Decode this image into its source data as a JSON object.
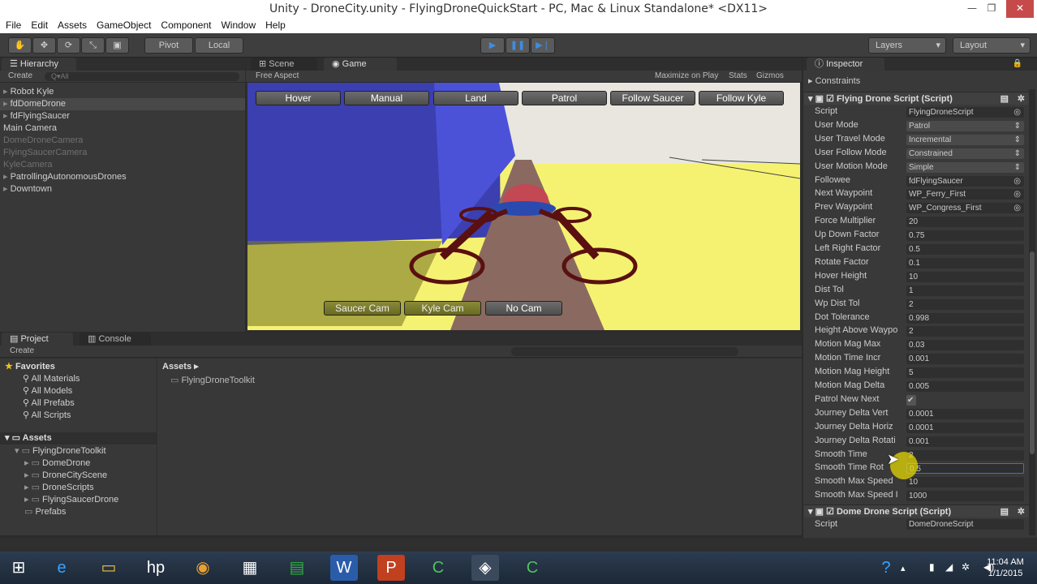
{
  "window": {
    "title": "Unity - DroneCity.unity - FlyingDroneQuickStart - PC, Mac & Linux Standalone* <DX11>"
  },
  "menu": [
    "File",
    "Edit",
    "Assets",
    "GameObject",
    "Component",
    "Window",
    "Help"
  ],
  "toolbar": {
    "pivot": "Pivot",
    "local": "Local",
    "layers": "Layers",
    "layout": "Layout"
  },
  "hierarchy": {
    "tab": "Hierarchy",
    "create": "Create",
    "search_placeholder": "Q▾All",
    "items": [
      {
        "label": "Robot Kyle",
        "dim": false,
        "arrow": true
      },
      {
        "label": "fdDomeDrone",
        "dim": false,
        "arrow": true,
        "selected": true
      },
      {
        "label": "fdFlyingSaucer",
        "dim": false,
        "arrow": true
      },
      {
        "label": "Main Camera",
        "dim": false,
        "arrow": false
      },
      {
        "label": "DomeDroneCamera",
        "dim": true,
        "arrow": false
      },
      {
        "label": "FlyingSaucerCamera",
        "dim": true,
        "arrow": false
      },
      {
        "label": "KyleCamera",
        "dim": true,
        "arrow": false
      },
      {
        "label": "PatrollingAutonomousDrones",
        "dim": false,
        "arrow": true
      },
      {
        "label": "Downtown",
        "dim": false,
        "arrow": true
      }
    ]
  },
  "scene_tab": "Scene",
  "game_tab": "Game",
  "game": {
    "aspect": "Free Aspect",
    "maximize": "Maximize on Play",
    "stats": "Stats",
    "gizmos": "Gizmos",
    "top_buttons": [
      "Hover",
      "Manual",
      "Land",
      "Patrol",
      "Follow Saucer",
      "Follow Kyle"
    ],
    "bottom_buttons": [
      "Saucer Cam",
      "Kyle Cam",
      "No Cam"
    ]
  },
  "project": {
    "tab": "Project",
    "console_tab": "Console",
    "create": "Create",
    "favorites_label": "Favorites",
    "favorites": [
      "All Materials",
      "All Models",
      "All Prefabs",
      "All Scripts"
    ],
    "assets_label": "Assets",
    "tree": [
      "FlyingDroneToolkit",
      "DomeDrone",
      "DroneCityScene",
      "DroneScripts",
      "FlyingSaucerDrone",
      "Prefabs"
    ],
    "breadcrumb": "Assets ▸",
    "content_folder": "FlyingDroneToolkit"
  },
  "inspector": {
    "tab": "Inspector",
    "constraints": "Constraints",
    "component_title": "Flying Drone Script (Script)",
    "fields": [
      {
        "label": "Script",
        "value": "FlyingDroneScript",
        "kind": "obj"
      },
      {
        "label": "User Mode",
        "value": "Patrol",
        "kind": "drop"
      },
      {
        "label": "User Travel Mode",
        "value": "Incremental",
        "kind": "drop"
      },
      {
        "label": "User Follow Mode",
        "value": "Constrained",
        "kind": "drop"
      },
      {
        "label": "User Motion Mode",
        "value": "Simple",
        "kind": "drop"
      },
      {
        "label": "Followee",
        "value": "fdFlyingSaucer",
        "kind": "obj"
      },
      {
        "label": "Next Waypoint",
        "value": "WP_Ferry_First",
        "kind": "obj"
      },
      {
        "label": "Prev Waypoint",
        "value": "WP_Congress_First",
        "kind": "obj"
      },
      {
        "label": "Force Multiplier",
        "value": "20",
        "kind": "field"
      },
      {
        "label": "Up Down Factor",
        "value": "0.75",
        "kind": "field"
      },
      {
        "label": "Left Right Factor",
        "value": "0.5",
        "kind": "field"
      },
      {
        "label": "Rotate Factor",
        "value": "0.1",
        "kind": "field"
      },
      {
        "label": "Hover Height",
        "value": "10",
        "kind": "field"
      },
      {
        "label": "Dist Tol",
        "value": "1",
        "kind": "field"
      },
      {
        "label": "Wp Dist Tol",
        "value": "2",
        "kind": "field"
      },
      {
        "label": "Dot Tolerance",
        "value": "0.998",
        "kind": "field"
      },
      {
        "label": "Height Above Waypo",
        "value": "2",
        "kind": "field"
      },
      {
        "label": "Motion Mag Max",
        "value": "0.03",
        "kind": "field"
      },
      {
        "label": "Motion Time Incr",
        "value": "0.001",
        "kind": "field"
      },
      {
        "label": "Motion Mag Height",
        "value": "5",
        "kind": "field"
      },
      {
        "label": "Motion Mag Delta",
        "value": "0.005",
        "kind": "field"
      },
      {
        "label": "Patrol New Next",
        "value": "✔",
        "kind": "check"
      },
      {
        "label": "Journey Delta Vert",
        "value": "0.0001",
        "kind": "field"
      },
      {
        "label": "Journey Delta Horiz",
        "value": "0.0001",
        "kind": "field"
      },
      {
        "label": "Journey Delta Rotati",
        "value": "0.001",
        "kind": "field"
      },
      {
        "label": "Smooth Time",
        "value": "2",
        "kind": "field"
      },
      {
        "label": "Smooth Time Rot",
        "value": "0.5",
        "kind": "field",
        "highlight": true
      },
      {
        "label": "Smooth Max Speed",
        "value": "10",
        "kind": "field"
      },
      {
        "label": "Smooth Max Speed I",
        "value": "1000",
        "kind": "field"
      }
    ],
    "component2_title": "Dome Drone Script (Script)",
    "script2_label": "Script",
    "script2_value": "DomeDroneScript"
  },
  "taskbar": {
    "time": "11:04 AM",
    "date": "1/1/2015"
  },
  "colors": {
    "accent_blue": "#3a6fd8",
    "play_blue": "#3d8de0",
    "highlight_yellow": "#f0e000"
  }
}
